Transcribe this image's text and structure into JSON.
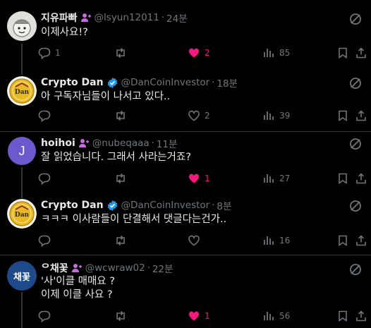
{
  "colors": {
    "background": "#000000",
    "text": "#e7e9ea",
    "muted": "#71767b",
    "like": "#f91880",
    "verified": "#1d9bf0",
    "badge_purple": "#c66cdb"
  },
  "tweets": [
    {
      "name": "지유파빠",
      "handle": "@lsyun12011",
      "time": "24분",
      "badge": "purple-person-icon",
      "avatar_label": "",
      "lines": [
        "이제사요!?"
      ],
      "reply": "1",
      "retweet": "",
      "like": "2",
      "liked": true,
      "views": "85"
    },
    {
      "name": "Crypto Dan",
      "handle": "@DanCoinInvestor",
      "time": "18분",
      "badge": "verified-check-icon",
      "avatar_label": "Dan",
      "lines": [
        "아 구독자님들이 나서고 있다.."
      ],
      "reply": "",
      "retweet": "",
      "like": "2",
      "liked": false,
      "views": "39"
    },
    {
      "name": "hoihoi",
      "handle": "@nubeqaaa",
      "time": "11분",
      "badge": "purple-person-icon",
      "avatar_label": "J",
      "lines": [
        "잘 읽었습니다. 그래서 사라는거죠?"
      ],
      "reply": "",
      "retweet": "",
      "like": "1",
      "liked": true,
      "views": "27"
    },
    {
      "name": "Crypto Dan",
      "handle": "@DanCoinInvestor",
      "time": "8분",
      "badge": "verified-check-icon",
      "avatar_label": "Dan",
      "lines": [
        "ㅋㅋㅋ 이사람들이 단결해서 댓글다는건가.."
      ],
      "reply": "",
      "retweet": "",
      "like": "",
      "liked": false,
      "views": "16"
    },
    {
      "name": "ᄋ채꽃",
      "handle": "@wcwraw02",
      "time": "22분",
      "badge": "purple-person-icon",
      "avatar_label": "채꽃",
      "lines": [
        "'사'이클 매매요 ?",
        "이제 이클 사요 ?"
      ],
      "reply": "",
      "retweet": "",
      "like": "1",
      "liked": true,
      "views": "56"
    }
  ]
}
